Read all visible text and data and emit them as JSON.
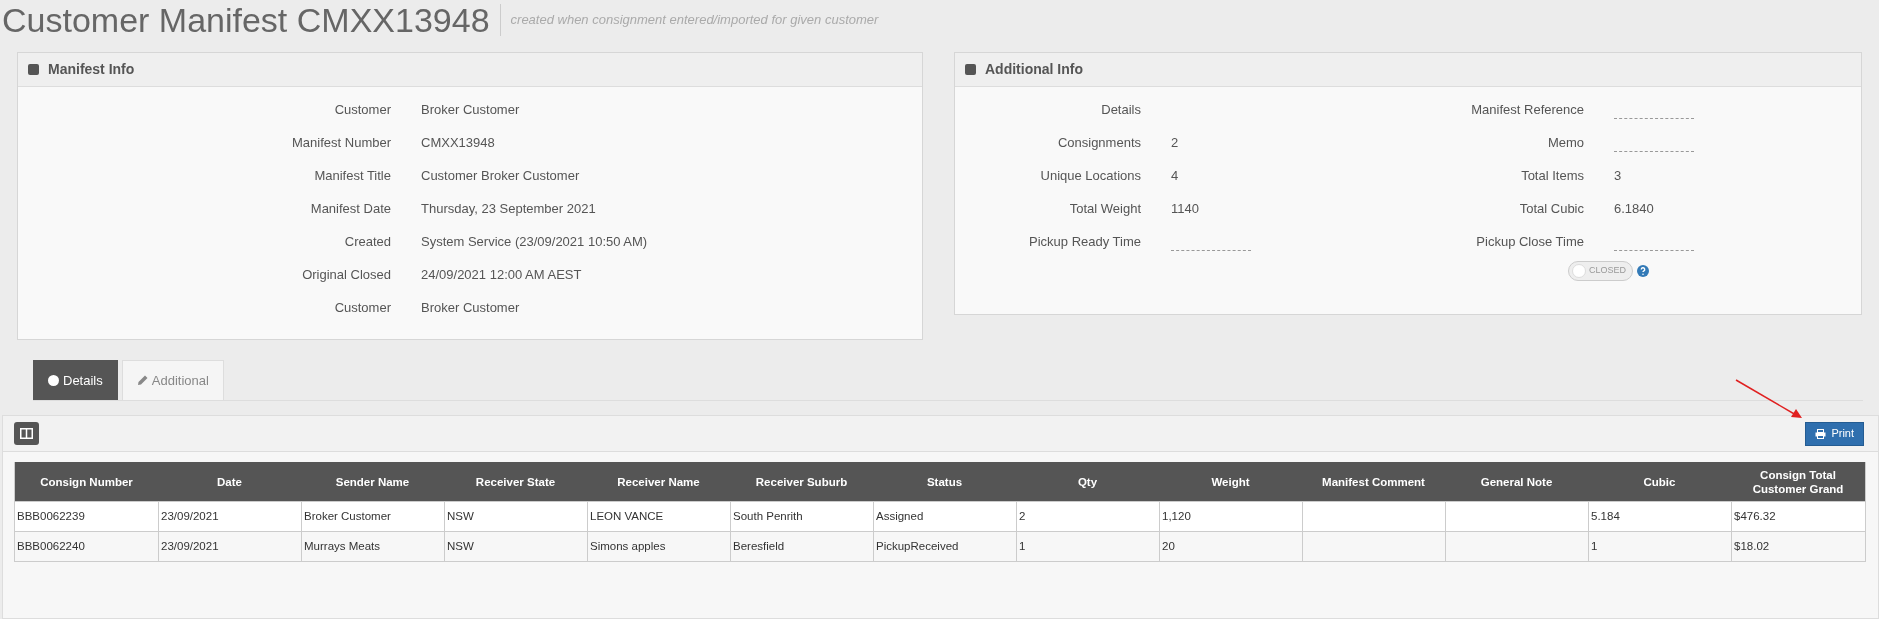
{
  "page": {
    "title": "Customer Manifest CMXX13948",
    "subtitle": "created when consignment entered/imported for given customer"
  },
  "manifest_info": {
    "title": "Manifest Info",
    "fields": [
      {
        "label": "Customer",
        "value": "Broker Customer"
      },
      {
        "label": "Manifest Number",
        "value": "CMXX13948"
      },
      {
        "label": "Manifest Title",
        "value": "Customer Broker Customer"
      },
      {
        "label": "Manifest Date",
        "value": "Thursday, 23 September 2021"
      },
      {
        "label": "Created",
        "value": "System Service (23/09/2021 10:50 AM)"
      },
      {
        "label": "Original Closed",
        "value": "24/09/2021 12:00 AM AEST"
      },
      {
        "label": "Customer",
        "value": "Broker Customer"
      }
    ]
  },
  "additional_info": {
    "title": "Additional Info",
    "left_fields": [
      {
        "label": "Details",
        "kind": "heading"
      },
      {
        "label": "Consignments",
        "kind": "text",
        "value": "2"
      },
      {
        "label": "Unique Locations",
        "kind": "text",
        "value": "4"
      },
      {
        "label": "Total Weight",
        "kind": "text",
        "value": "1140"
      },
      {
        "label": "Pickup Ready Time",
        "kind": "empty"
      }
    ],
    "right_fields": [
      {
        "label": "Manifest Reference",
        "kind": "empty"
      },
      {
        "label": "Memo",
        "kind": "empty"
      },
      {
        "label": "Total Items",
        "kind": "text",
        "value": "3"
      },
      {
        "label": "Total Cubic",
        "kind": "text",
        "value": "6.1840"
      },
      {
        "label": "Pickup Close Time",
        "kind": "empty"
      }
    ],
    "closed_toggle": {
      "label": "CLOSED",
      "on": false
    }
  },
  "tabs": [
    {
      "label": "Details",
      "selected": true
    },
    {
      "label": "Additional",
      "selected": false
    }
  ],
  "toolbar": {
    "print_button": "Print"
  },
  "table": {
    "columns": [
      "Consign Number",
      "Date",
      "Sender Name",
      "Receiver State",
      "Receiver Name",
      "Receiver Suburb",
      "Status",
      "Qty",
      "Weight",
      "Manifest Comment",
      "General Note",
      "Cubic",
      "Consign Total Customer Grand"
    ],
    "rows": [
      [
        "BBB0062239",
        "23/09/2021",
        "Broker Customer",
        "NSW",
        "LEON VANCE",
        "South Penrith",
        "Assigned",
        "2",
        "1,120",
        "",
        "",
        "5.184",
        "$476.32"
      ],
      [
        "BBB0062240",
        "23/09/2021",
        "Murrays Meats",
        "NSW",
        "Simons apples",
        "Beresfield",
        "PickupReceived",
        "1",
        "20",
        "",
        "",
        "1",
        "$18.02"
      ]
    ]
  }
}
